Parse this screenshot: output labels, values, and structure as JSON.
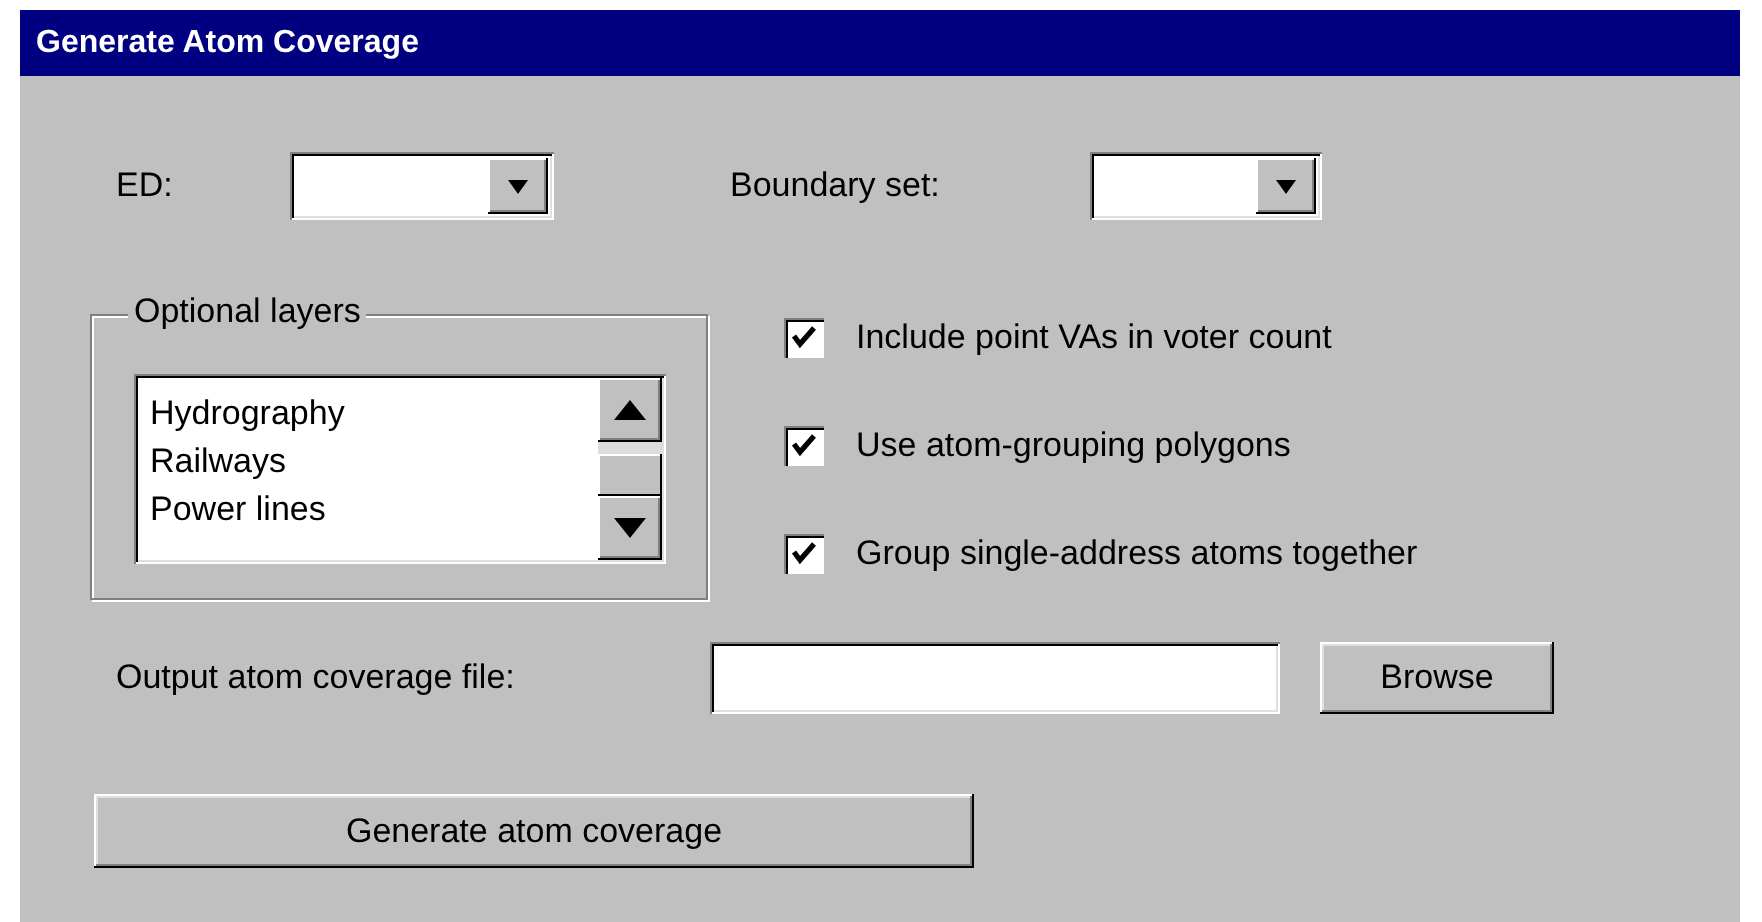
{
  "window": {
    "title": "Generate Atom Coverage"
  },
  "ed": {
    "label": "ED:"
  },
  "boundary_set": {
    "label": "Boundary set:"
  },
  "optional_layers": {
    "title": "Optional layers",
    "items": [
      {
        "label": "Hydrography",
        "selected": false
      },
      {
        "label": "Railways",
        "selected": false
      },
      {
        "label": "Power lines",
        "selected": false
      }
    ]
  },
  "options": [
    {
      "label": "Include point VAs in voter count",
      "checked": true
    },
    {
      "label": "Use atom-grouping polygons",
      "checked": true
    },
    {
      "label": "Group single-address atoms together",
      "checked": true
    }
  ],
  "output": {
    "label": "Output atom coverage file:",
    "browse_button": "Browse"
  },
  "generate_button": "Generate atom coverage"
}
